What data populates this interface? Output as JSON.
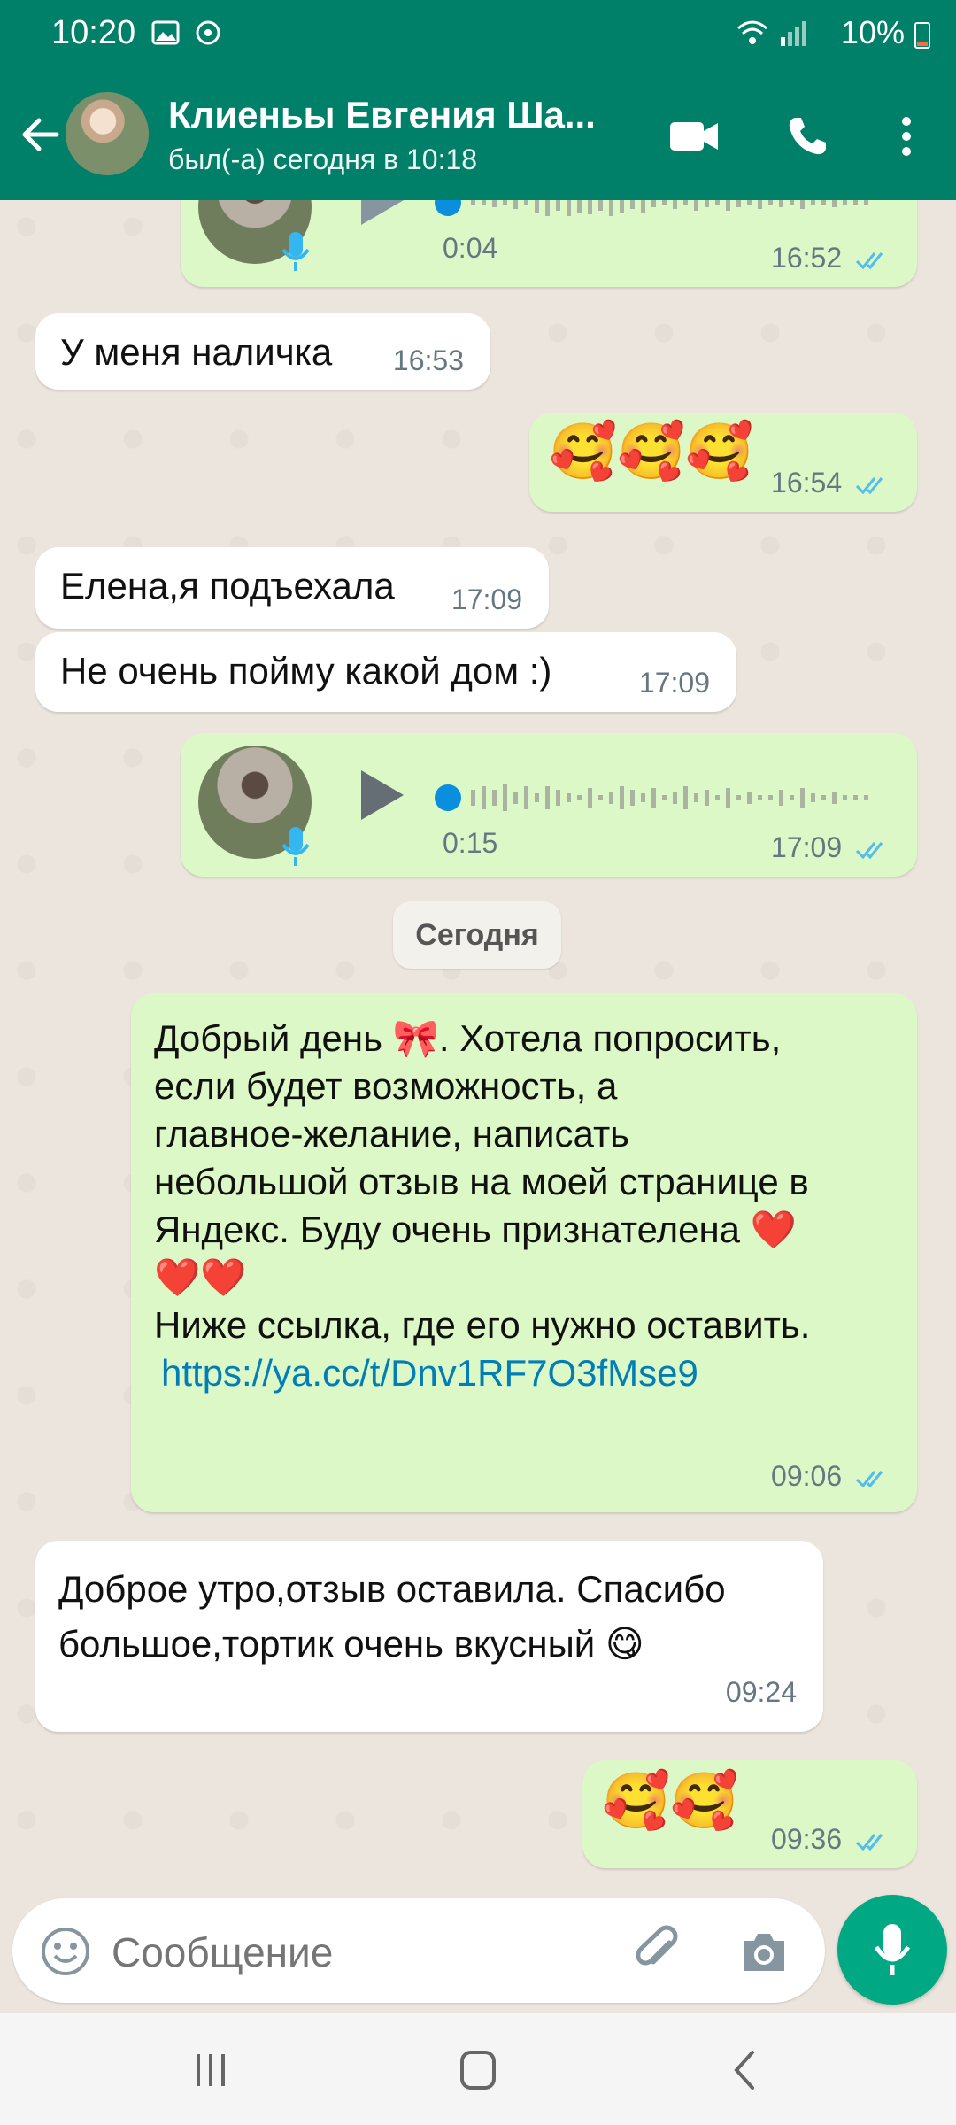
{
  "status_bar": {
    "time": "10:20",
    "battery": "10%"
  },
  "header": {
    "contact_name": "Клиеньы Евгения Ша...",
    "contact_status": "был(-а) сегодня в 10:18"
  },
  "messages": [
    {
      "type": "voice",
      "direction": "out",
      "duration": "0:04",
      "time": "16:52"
    },
    {
      "type": "text",
      "direction": "in",
      "text": "У меня наличка",
      "time": "16:53"
    },
    {
      "type": "emoji",
      "direction": "out",
      "text": "🥰🥰🥰",
      "time": "16:54"
    },
    {
      "type": "text",
      "direction": "in",
      "text": "Елена,я подъехала",
      "time": "17:09"
    },
    {
      "type": "text",
      "direction": "in",
      "text": "Не очень пойму какой дом :)",
      "time": "17:09"
    },
    {
      "type": "voice",
      "direction": "out",
      "duration": "0:15",
      "time": "17:09"
    },
    {
      "type": "text",
      "direction": "out",
      "lines": [
        "Добрый день 🎀.  Хотела попросить,",
        "если будет возможность,  а",
        "главное-желание,  написать",
        "небольшой отзыв на моей странице в",
        "Яндекс.  Буду очень признателена ❤️",
        "❤️❤️",
        "Ниже ссылка, где его нужно оставить."
      ],
      "link": "https://ya.cc/t/Dnv1RF7O3fMse9",
      "time": "09:06"
    },
    {
      "type": "text",
      "direction": "in",
      "lines": [
        "Доброе утро,отзыв оставила. Спасибо",
        "большое,тортик очень вкусный 😋"
      ],
      "time": "09:24"
    },
    {
      "type": "emoji",
      "direction": "out",
      "text": "🥰🥰",
      "time": "09:36"
    }
  ],
  "date_separator": "Сегодня",
  "input": {
    "placeholder": "Сообщение"
  },
  "colors": {
    "header": "#008069",
    "outgoing_bubble": "#dcf8c6",
    "incoming_bubble": "#ffffff",
    "read_ticks": "#53bdeb",
    "fab": "#00a884"
  }
}
